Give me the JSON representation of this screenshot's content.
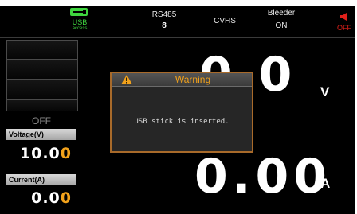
{
  "status": {
    "usb": {
      "icon": "usb-plug-icon",
      "label": "USB",
      "sublabel": "access",
      "color": "#3fd63f"
    },
    "rs485": {
      "label": "RS485",
      "value": "8"
    },
    "mode": {
      "label": "CVHS"
    },
    "bleeder": {
      "label": "Bleeder",
      "value": "ON"
    },
    "buzzer": {
      "icon": "speaker-icon",
      "label": "OFF",
      "color": "#e0201a"
    }
  },
  "left_panel": {
    "output_state": "OFF",
    "voltage": {
      "label": "Voltage(V)",
      "value_main": "10.0",
      "value_cursor_digit": "0"
    },
    "current": {
      "label": "Current(A)",
      "value_main": "0.0",
      "value_cursor_digit": "0"
    },
    "accent": "#f2a21b"
  },
  "readouts": {
    "voltage_partial": "0 0",
    "voltage_unit": "V",
    "current": "0.00",
    "current_unit": "A"
  },
  "dialog": {
    "icon": "warning-triangle-icon",
    "title": "Warning",
    "message": "USB stick is inserted.",
    "title_color": "#f2a21b"
  }
}
